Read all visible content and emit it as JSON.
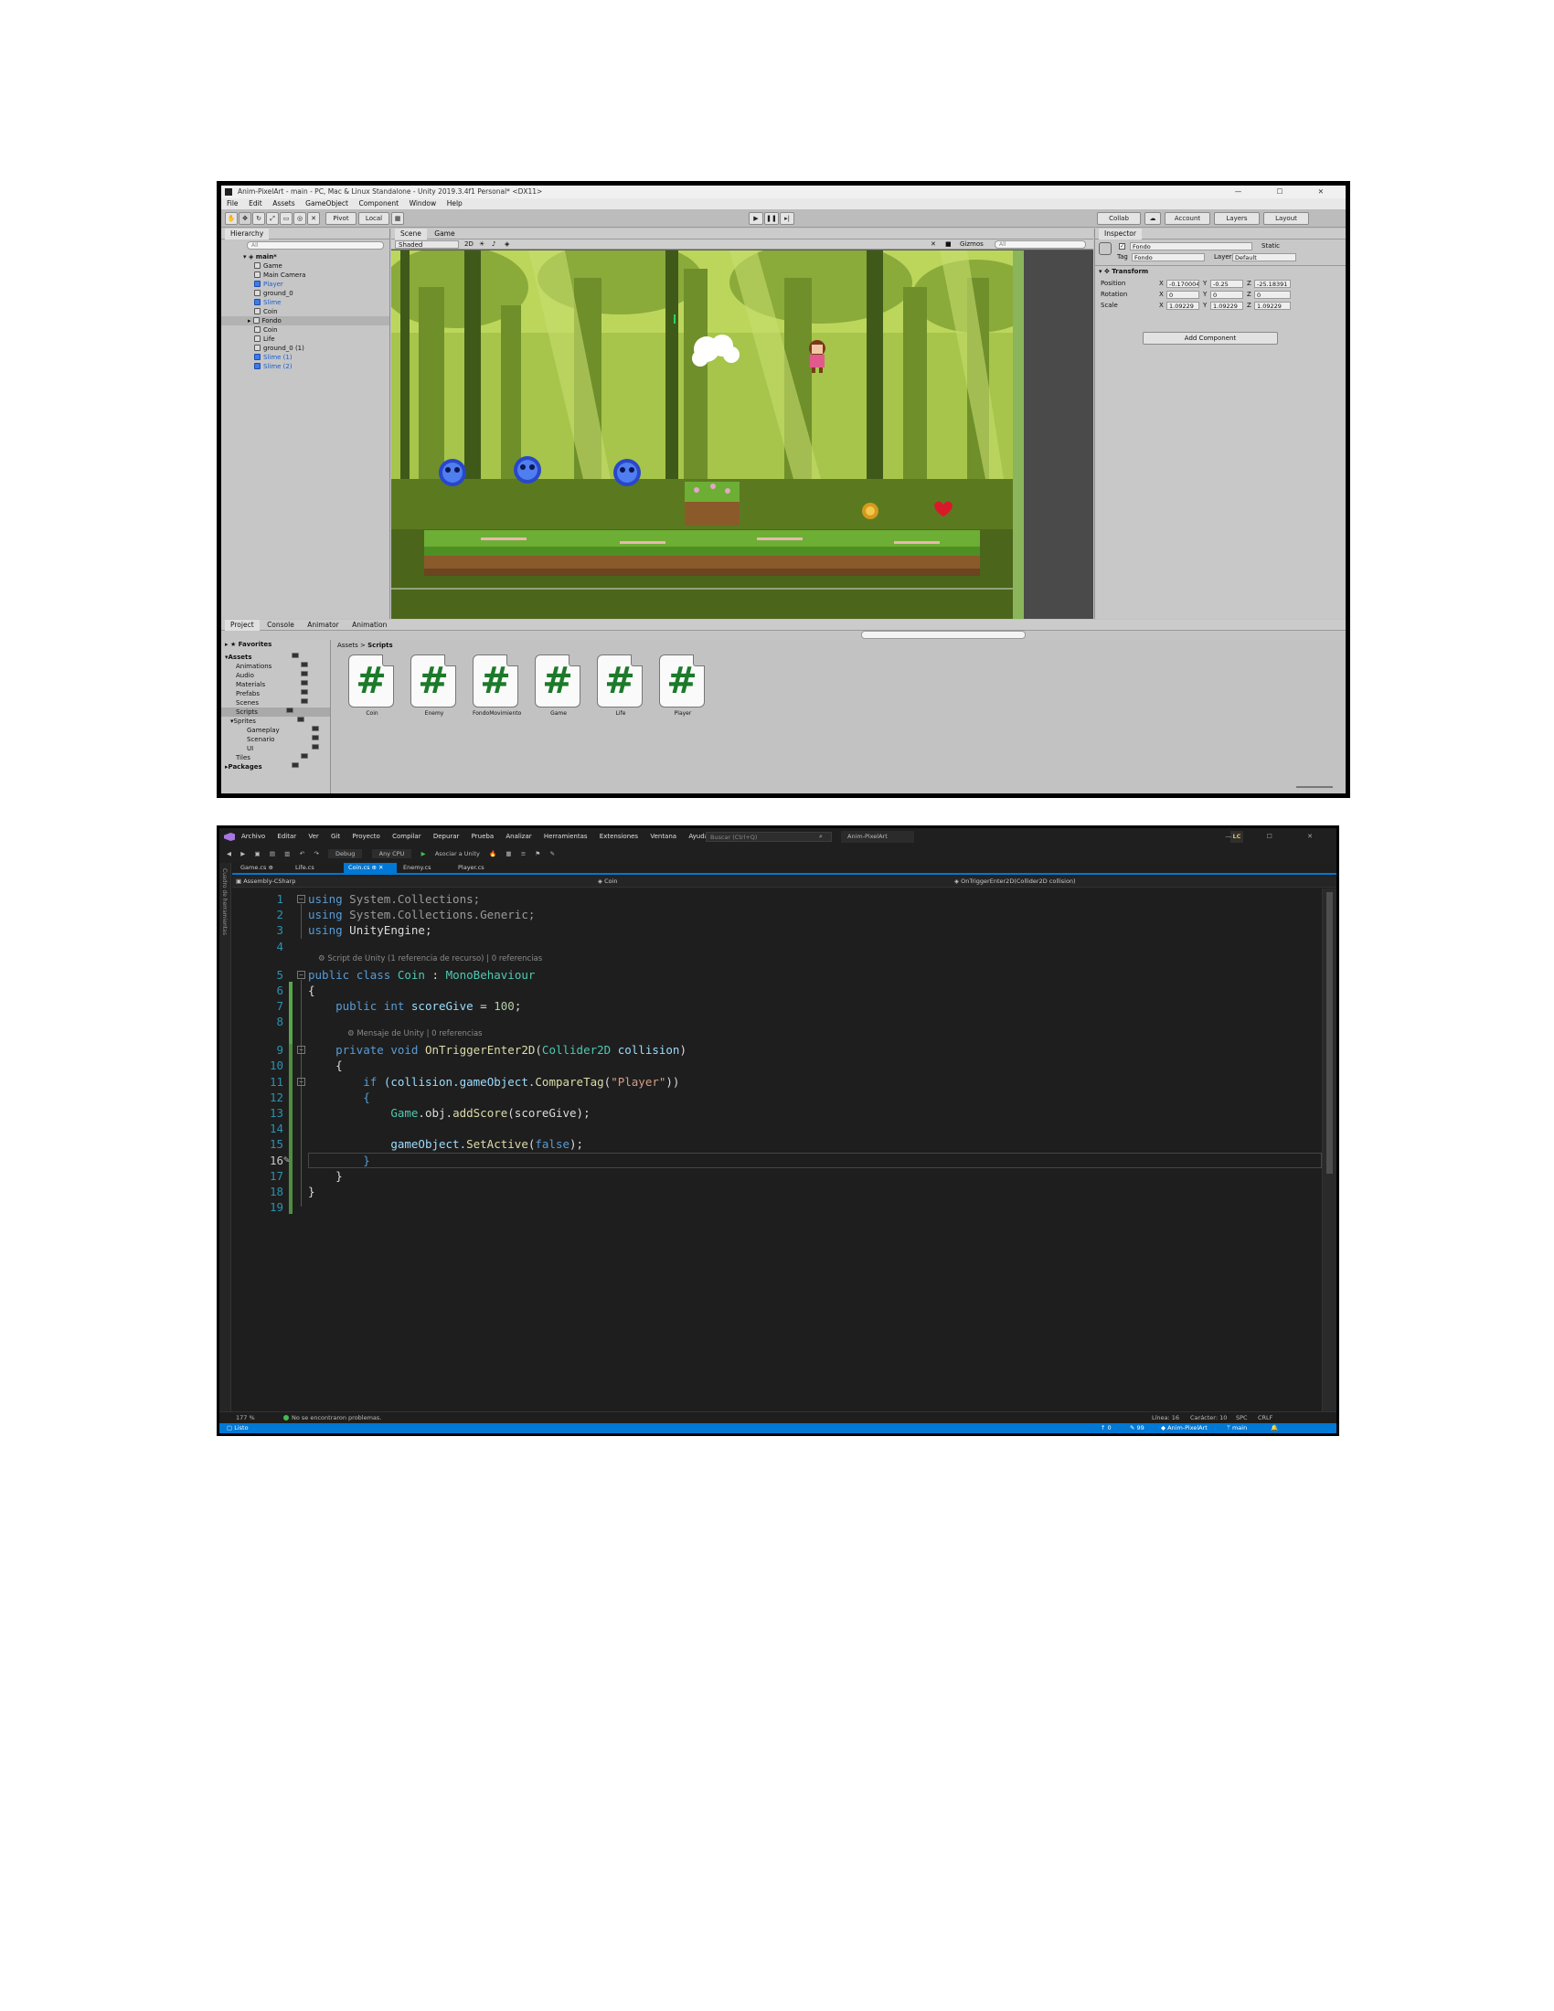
{
  "unity": {
    "window_title": "Anim-PixelArt - main - PC, Mac & Linux Standalone - Unity 2019.3.4f1 Personal* <DX11>",
    "menu": [
      "File",
      "Edit",
      "Assets",
      "GameObject",
      "Component",
      "Window",
      "Help"
    ],
    "toolbar": {
      "pivot": "Pivot",
      "local": "Local",
      "collab": "Collab",
      "account": "Account",
      "layers": "Layers",
      "layout": "Layout"
    },
    "hierarchy": {
      "tab": "Hierarchy",
      "search_placeholder": "All",
      "scene": "main*",
      "items": [
        {
          "label": "Game",
          "blue": false
        },
        {
          "label": "Main Camera",
          "blue": false
        },
        {
          "label": "Player",
          "blue": true
        },
        {
          "label": "ground_0",
          "blue": false
        },
        {
          "label": "Slime",
          "blue": true
        },
        {
          "label": "Coin",
          "blue": false
        },
        {
          "label": "Fondo",
          "blue": false
        },
        {
          "label": "Coin",
          "blue": false
        },
        {
          "label": "Life",
          "blue": false
        },
        {
          "label": "ground_0 (1)",
          "blue": false
        },
        {
          "label": "Slime (1)",
          "blue": true
        },
        {
          "label": "Slime (2)",
          "blue": true
        }
      ]
    },
    "scene": {
      "tabs": [
        "Scene",
        "Game"
      ],
      "shading": "Shaded",
      "mode_2d": "2D",
      "gizmos": "Gizmos",
      "search_placeholder": "All"
    },
    "inspector": {
      "tab": "Inspector",
      "object_name": "Fondo",
      "static_label": "Static",
      "tag_label": "Tag",
      "tag_value": "Fondo",
      "layer_label": "Layer",
      "layer_value": "Default",
      "component": "Transform",
      "rows": [
        {
          "label": "Position",
          "x": "-0.170004",
          "y": "-0.25",
          "z": "-25.18391"
        },
        {
          "label": "Rotation",
          "x": "0",
          "y": "0",
          "z": "0"
        },
        {
          "label": "Scale",
          "x": "1.09229",
          "y": "1.09229",
          "z": "1.09229"
        }
      ],
      "axis_x": "X",
      "axis_y": "Y",
      "axis_z": "Z",
      "add_component": "Add Component"
    },
    "project": {
      "tabs": [
        "Project",
        "Console",
        "Animator",
        "Animation"
      ],
      "favorites": "Favorites",
      "tree": [
        "Assets",
        "Animations",
        "Audio",
        "Materials",
        "Prefabs",
        "Scenes",
        "Scripts",
        "Sprites",
        "Gameplay",
        "Scenario",
        "UI",
        "Tiles",
        "Packages"
      ],
      "breadcrumb_root": "Assets",
      "breadcrumb_sep": ">",
      "breadcrumb_leaf": "Scripts",
      "script_glyph": "#",
      "scripts": [
        "Coin",
        "Enemy",
        "FondoMovimiento",
        "Game",
        "Life",
        "Player"
      ]
    }
  },
  "vs": {
    "menu": [
      "Archivo",
      "Editar",
      "Ver",
      "Git",
      "Proyecto",
      "Compilar",
      "Depurar",
      "Prueba",
      "Analizar",
      "Herramientas",
      "Extensiones",
      "Ventana",
      "Ayuda"
    ],
    "search_placeholder": "Buscar (Ctrl+Q)",
    "project_name": "Anim-PixelArt",
    "avatar": "LC",
    "toolbar": {
      "config": "Debug",
      "platform": "Any CPU",
      "attach": "Asociar a Unity"
    },
    "side_label": "Cuadro de herramientas",
    "tabs": [
      {
        "label": "Game.cs",
        "active": false
      },
      {
        "label": "Life.cs",
        "active": false
      },
      {
        "label": "Coin.cs",
        "active": true
      },
      {
        "label": "Enemy.cs",
        "active": false
      },
      {
        "label": "Player.cs",
        "active": false
      }
    ],
    "nav": {
      "project": "Assembly-CSharp",
      "class": "Coin",
      "member": "OnTriggerEnter2D(Collider2D collision)"
    },
    "lens": {
      "class": "Script de Unity (1 referencia de recurso) | 0 referencias",
      "method": "Mensaje de Unity | 0 referencias"
    },
    "code": {
      "l1": [
        "using",
        "System.Collections;"
      ],
      "l2": [
        "using",
        "System.Collections.Generic;"
      ],
      "l3": [
        "using",
        "UnityEngine;"
      ],
      "l5": [
        "public",
        "class",
        "Coin",
        ":",
        "MonoBehaviour"
      ],
      "l7": [
        "public",
        "int",
        "scoreGive",
        "=",
        "100",
        ";"
      ],
      "l9": [
        "private",
        "void",
        "OnTriggerEnter2D",
        "(",
        "Collider2D",
        "collision",
        ")"
      ],
      "l11": [
        "if",
        "(collision.gameObject.",
        "CompareTag",
        "(",
        "\"Player\"",
        "))"
      ],
      "l13": [
        "Game",
        ".obj.",
        "addScore",
        "(scoreGive);"
      ],
      "l15": [
        "gameObject.",
        "SetActive",
        "(",
        "false",
        ");"
      ],
      "open": "{",
      "close": "}"
    },
    "line_numbers": [
      "1",
      "2",
      "3",
      "4",
      "5",
      "6",
      "7",
      "8",
      "9",
      "10",
      "11",
      "12",
      "13",
      "14",
      "15",
      "16",
      "17",
      "18",
      "19"
    ],
    "status": {
      "zoom": "177 %",
      "problems": "No se encontraron problemas.",
      "line": "Línea: 16",
      "col": "Carácter: 10",
      "spc": "SPC",
      "crlf": "CRLF",
      "ready": "Listo",
      "branch_repo": "Anim-PixelArt",
      "branch": "main",
      "up": "0",
      "edits": "99"
    }
  }
}
